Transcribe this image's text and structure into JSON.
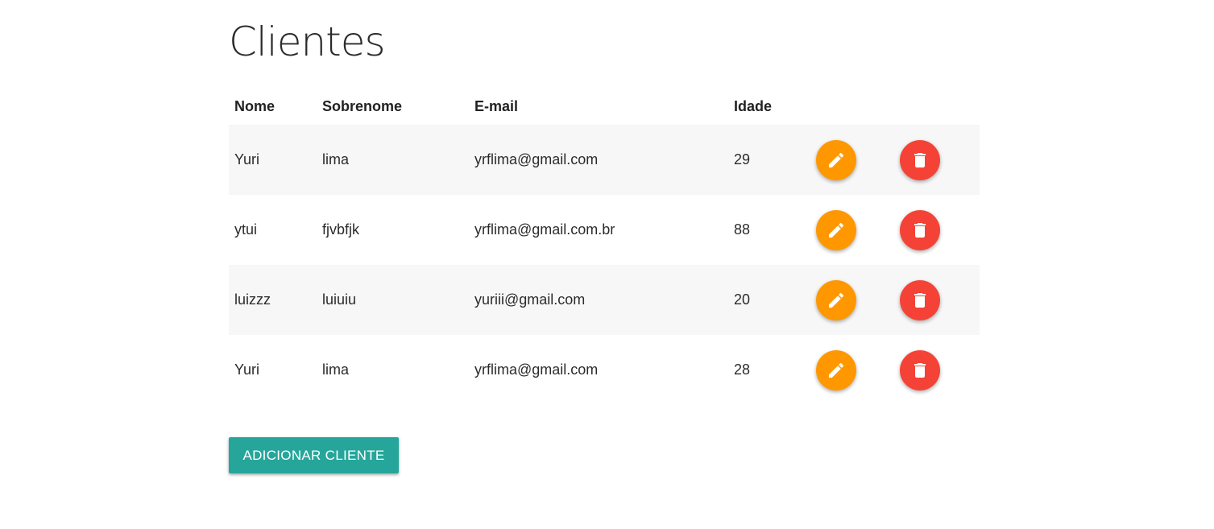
{
  "page": {
    "title": "Clientes"
  },
  "table": {
    "headers": {
      "nome": "Nome",
      "sobrenome": "Sobrenome",
      "email": "E-mail",
      "idade": "Idade"
    },
    "rows": [
      {
        "nome": "Yuri",
        "sobrenome": "lima",
        "email": "yrflima@gmail.com",
        "idade": "29"
      },
      {
        "nome": "ytui",
        "sobrenome": "fjvbfjk",
        "email": "yrflima@gmail.com.br",
        "idade": "88"
      },
      {
        "nome": "luizzz",
        "sobrenome": "luiuiu",
        "email": "yuriii@gmail.com",
        "idade": "20"
      },
      {
        "nome": "Yuri",
        "sobrenome": "lima",
        "email": "yrflima@gmail.com",
        "idade": "28"
      }
    ],
    "row_actions": {
      "edit_icon": "pencil-icon",
      "delete_icon": "trash-icon"
    }
  },
  "actions": {
    "add_label": "ADICIONAR CLIENTE"
  },
  "colors": {
    "edit": "#ff9800",
    "delete": "#f44336",
    "primary": "#26a69a",
    "row_stripe": "#f7f7f7"
  }
}
